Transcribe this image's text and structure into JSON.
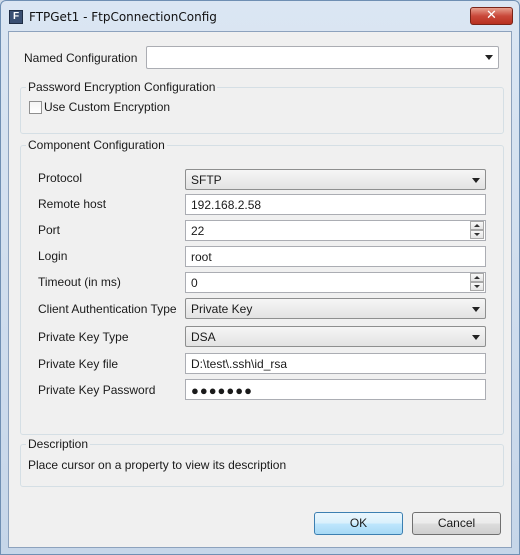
{
  "window": {
    "title": "FTPGet1 - FtpConnectionConfig",
    "icon_letter": "F",
    "close_glyph": "✕"
  },
  "named_configuration": {
    "label": "Named Configuration",
    "value": ""
  },
  "password_encryption": {
    "title": "Password Encryption Configuration",
    "use_custom_label": "Use Custom Encryption",
    "use_custom_checked": false
  },
  "component_configuration": {
    "title": "Component Configuration",
    "protocol": {
      "label": "Protocol",
      "value": "SFTP"
    },
    "remote_host": {
      "label": "Remote host",
      "value": "192.168.2.58"
    },
    "port": {
      "label": "Port",
      "value": "22"
    },
    "login": {
      "label": "Login",
      "value": "root"
    },
    "timeout": {
      "label": "Timeout (in ms)",
      "value": "0"
    },
    "client_auth_type": {
      "label": "Client Authentication Type",
      "value": "Private Key"
    },
    "private_key_type": {
      "label": "Private Key Type",
      "value": "DSA"
    },
    "private_key_file": {
      "label": "Private Key file",
      "value": "D:\\test\\.ssh\\id_rsa"
    },
    "private_key_password": {
      "label": "Private Key Password",
      "value": "●●●●●●●"
    }
  },
  "description": {
    "title": "Description",
    "text": "Place cursor on a property to view its description"
  },
  "buttons": {
    "ok": "OK",
    "cancel": "Cancel"
  },
  "icons": {
    "app": "app-icon",
    "close": "close-icon",
    "dropdown": "chevron-down-icon",
    "spin_up": "spin-up-icon",
    "spin_down": "spin-down-icon"
  }
}
